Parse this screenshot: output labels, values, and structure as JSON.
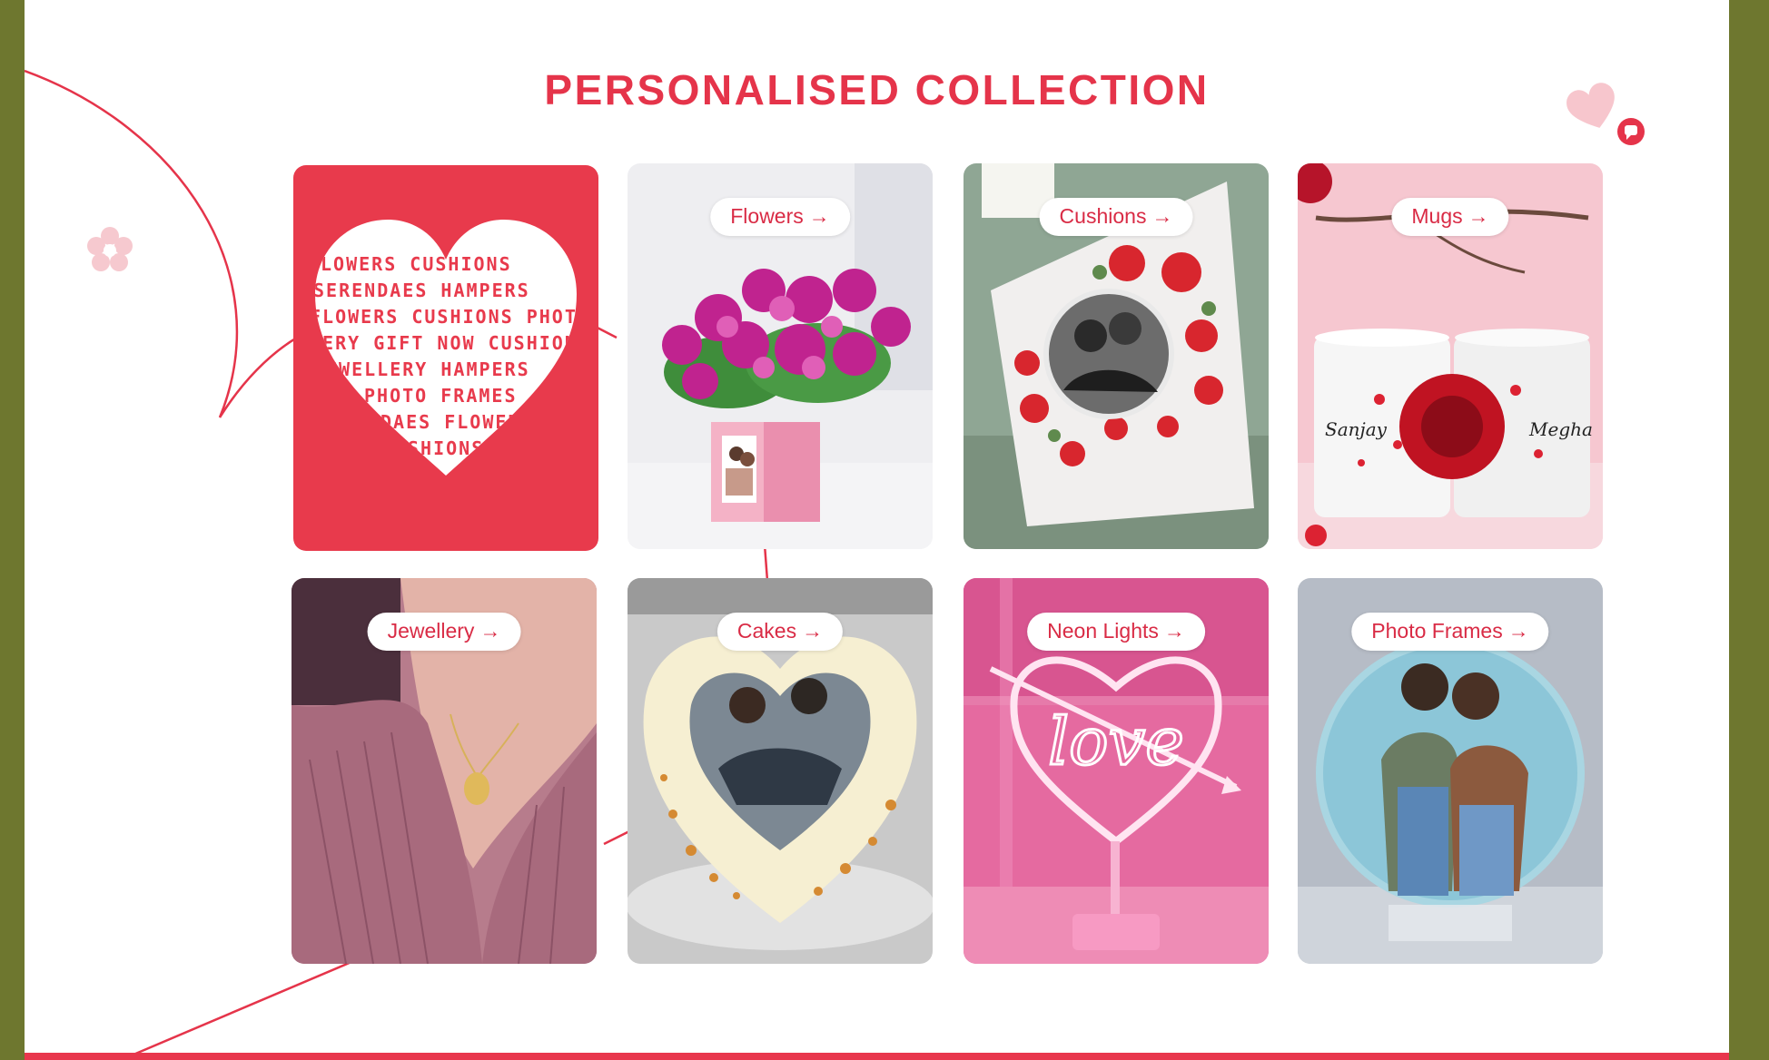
{
  "section": {
    "title": "PERSONALISED COLLECTION"
  },
  "heart_words": [
    "LOWERS CUSHIONS",
    "SERENDAES HAMPERS",
    "FLOWERS CUSHIONS PHOTO",
    "LERY GIFT NOW CUSHIONS",
    "EWELLERY HAMPERS",
    "PHOTO FRAMES",
    "DAES FLOWERS",
    "SHIONS"
  ],
  "tiles": [
    {
      "label": "Flowers",
      "arrow": "→"
    },
    {
      "label": "Cushions",
      "arrow": "→"
    },
    {
      "label": "Mugs",
      "arrow": "→"
    },
    {
      "label": "Jewellery",
      "arrow": "→"
    },
    {
      "label": "Cakes",
      "arrow": "→"
    },
    {
      "label": "Neon Lights",
      "arrow": "→"
    },
    {
      "label": "Photo Frames",
      "arrow": "→"
    }
  ],
  "mug_names": {
    "left": "Sanjay",
    "right": "Megha"
  },
  "neon_text": "love",
  "colors": {
    "brand_red": "#e5344a",
    "frame_olive": "#6e772f",
    "pill_text": "#d92b45"
  },
  "icons": [
    "flower-icon",
    "heart-icon",
    "chat-bubble-icon"
  ]
}
